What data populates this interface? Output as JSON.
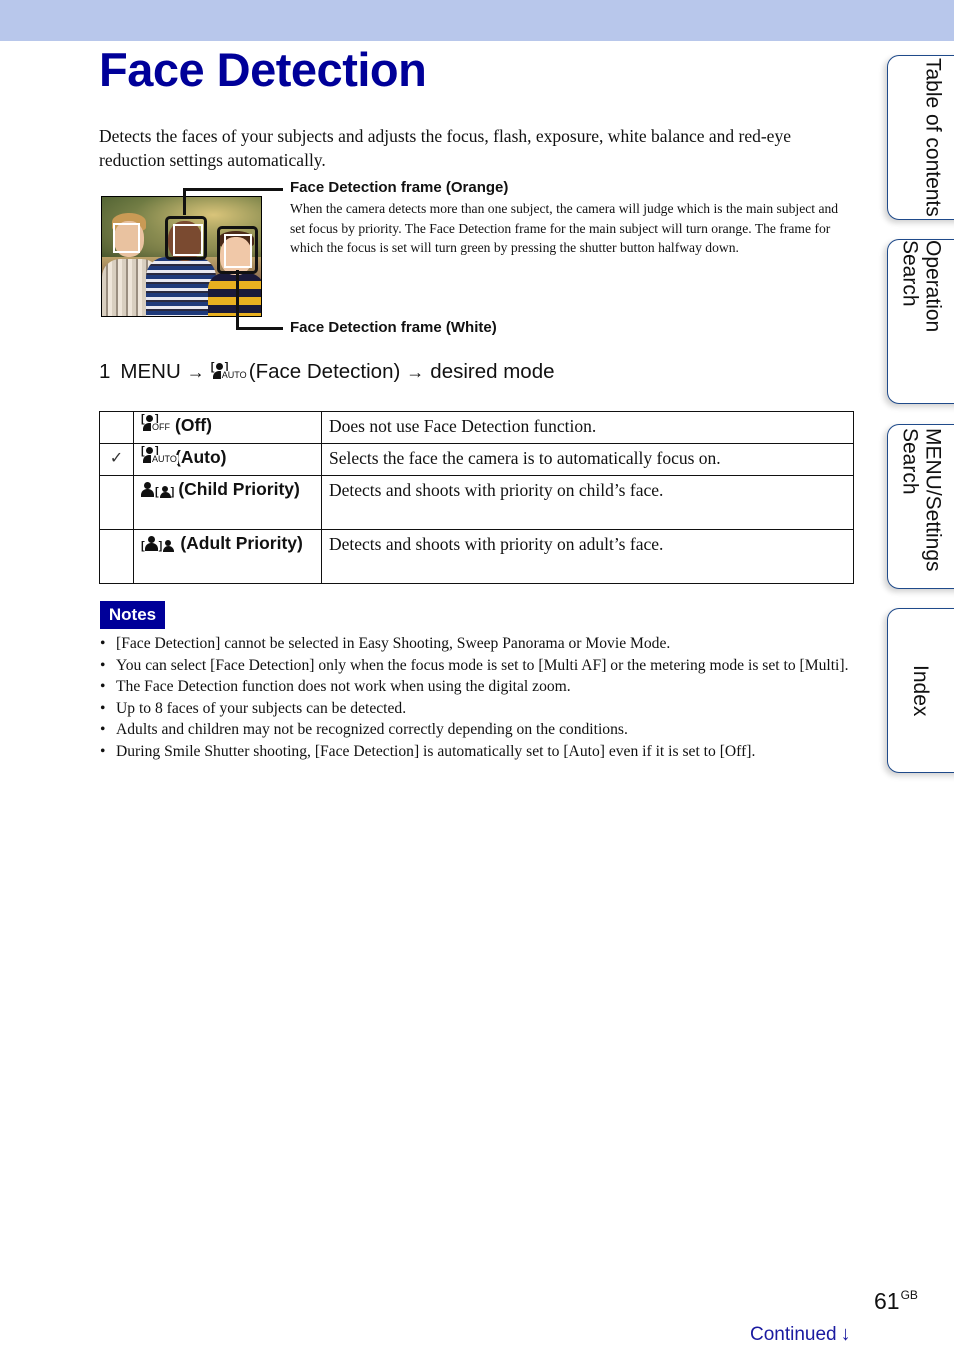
{
  "page": {
    "title": "Face Detection",
    "intro": "Detects the faces of your subjects and adjusts the focus, flash, exposure, white balance and red-eye reduction settings automatically.",
    "colors": {
      "header_band": "#b8c7eb",
      "title": "#000099",
      "notes_badge": "#000099",
      "tab_border": "#1f4a8a",
      "continued": "#1a1aa0"
    }
  },
  "illustration": {
    "image_alt": "three children with face detection frames",
    "callout_orange": {
      "heading": "Face Detection frame (Orange)",
      "body": "When the camera detects more than one subject, the camera will judge which is the main subject and set focus by priority. The Face Detection frame for the main subject will turn orange. The frame for which the focus is set will turn green by pressing the shutter button halfway down."
    },
    "callout_white": {
      "heading": "Face Detection frame (White)"
    }
  },
  "step": {
    "number": "1",
    "menu": "MENU",
    "arrow": "→",
    "icon": "face-detection-auto-icon",
    "icon_sub": "AUTO",
    "item": "(Face Detection)",
    "target": "desired mode"
  },
  "modes": [
    {
      "checked": false,
      "icon": "face-detection-off-icon",
      "icon_sub": "OFF",
      "label": "(Off)",
      "description": "Does not use Face Detection function."
    },
    {
      "checked": true,
      "check_glyph": "✓",
      "icon": "face-detection-auto-icon",
      "icon_sub": "AUTO",
      "label": "(Auto)",
      "description": "Selects the face the camera is to automatically focus on."
    },
    {
      "checked": false,
      "icon": "child-priority-icon",
      "label": "(Child Priority)",
      "description": "Detects and shoots with priority on child’s face."
    },
    {
      "checked": false,
      "icon": "adult-priority-icon",
      "label": "(Adult Priority)",
      "description": "Detects and shoots with priority on adult’s face."
    }
  ],
  "notes": {
    "badge": "Notes",
    "items": [
      "[Face Detection] cannot be selected in Easy Shooting, Sweep Panorama or Movie Mode.",
      "You can select [Face Detection] only when the focus mode is set to [Multi AF] or the metering mode is set to [Multi].",
      "The Face Detection function does not work when using the digital zoom.",
      "Up to 8 faces of your subjects can be detected.",
      "Adults and children may not be recognized correctly depending on the conditions.",
      "During Smile Shutter shooting, [Face Detection] is automatically set to [Auto] even if it is set to [Off]."
    ]
  },
  "side_tabs": [
    {
      "label": "Table of contents"
    },
    {
      "label": "Operation Search"
    },
    {
      "label": "MENU/Settings Search"
    },
    {
      "label": "Index"
    }
  ],
  "footer": {
    "page_number": "61",
    "page_suffix": "GB",
    "continued": "Continued",
    "continued_arrow": "↓"
  }
}
